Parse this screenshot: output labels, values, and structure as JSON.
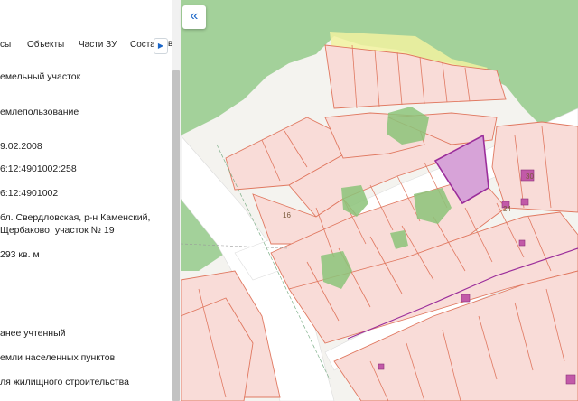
{
  "tabs": [
    {
      "label": "сы"
    },
    {
      "label": "Объекты"
    },
    {
      "label": "Части ЗУ"
    },
    {
      "label": "Соста"
    }
  ],
  "tab_cut_char": "в",
  "info_rows": [
    {
      "text": "емельный участок"
    },
    {
      "text": "емлепользование"
    },
    {
      "text": "9.02.2008"
    },
    {
      "text": "6:12:4901002:258"
    },
    {
      "text": "6:12:4901002"
    },
    {
      "text": "бл. Свердловская, р-н Каменский,"
    },
    {
      "text": "Щербаково, участок № 19"
    },
    {
      "text": "293 кв. м"
    },
    {
      "text": "анее учтенный"
    },
    {
      "text": "емли населенных пунктов"
    },
    {
      "text": "ля жилищного строительства"
    }
  ],
  "map": {
    "collapse_icon": "«",
    "labels": [
      {
        "text": "16"
      },
      {
        "text": "30"
      },
      {
        "text": "24"
      }
    ],
    "colors": {
      "background": "#f4f3ef",
      "forest": "#a3d19a",
      "parcel_fill": "#f9dcd8",
      "parcel_line": "#e07860",
      "selected_fill": "#d7a3d8",
      "selected_line": "#9b2e9b",
      "road": "#ffffff",
      "highlight": "#f2f2a0"
    }
  }
}
